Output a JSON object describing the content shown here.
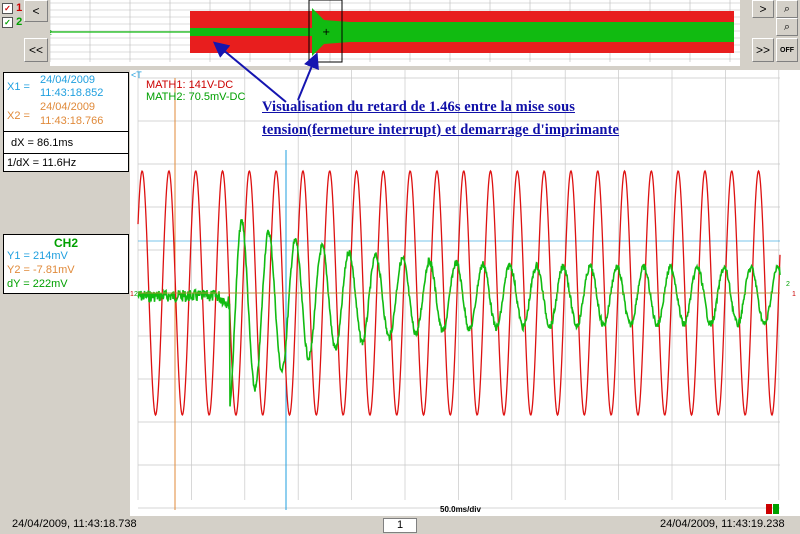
{
  "channels": [
    {
      "label": "1",
      "checked": true,
      "color": "#cc0000"
    },
    {
      "label": "2",
      "checked": true,
      "color": "#00a000"
    }
  ],
  "nav": {
    "prev_label": "<",
    "rewind_label": "<<",
    "next_label": ">",
    "forward_label": ">>",
    "off_label": "OFF"
  },
  "cursors": {
    "x1_label": "X1 =",
    "x1_date": "24/04/2009",
    "x1_time": "11:43:18.852",
    "x2_label": "X2 =",
    "x2_date": "24/04/2009",
    "x2_time": "11:43:18.766",
    "dx": "dX = 86.1ms",
    "inv_dx": "1/dX = 11.6Hz"
  },
  "ch2_box": {
    "title": "CH2",
    "y1": "Y1 = 214mV",
    "y2": "Y2 = -7.81mV",
    "dy": "dY = 222mV"
  },
  "math": {
    "math1": "MATH1: 141V-DC",
    "math2": "MATH2: 70.5mV-DC"
  },
  "annotation": {
    "line1": "Visualisation du retard de 1.46s entre la mise sous",
    "line2": "tension(fermeture interrupt) et demarrage d'imprimante"
  },
  "scope": {
    "timebase": "50.0ms/div",
    "trigger_marker": "<T",
    "ch1_marker": "1",
    "ch2_marker": "2",
    "cross_marker": "+"
  },
  "status": {
    "left_time": "24/04/2009, 11:43:18.738",
    "page": "1",
    "right_time": "24/04/2009, 11:43:19.238"
  },
  "colors": {
    "ch1": "#dd1111",
    "ch2": "#11bb11",
    "cursor_x1": "#1f9fdf",
    "cursor_x2": "#e08a3a",
    "annotation": "#1010a8"
  }
}
